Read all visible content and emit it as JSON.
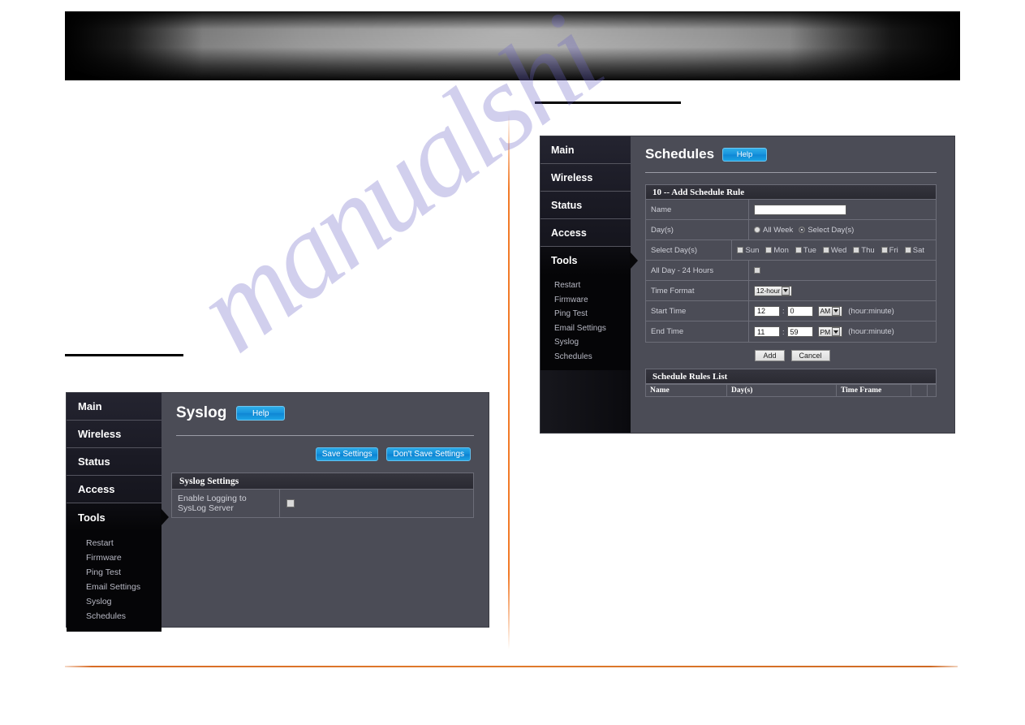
{
  "page": {
    "watermark_text": "manualshi",
    "accent_orange": "#d86c26",
    "panel_bg": "#4b4c56",
    "nav_bg": "#0a0a0e",
    "help_blue": "#1793dd"
  },
  "syslog_window": {
    "nav": {
      "main_items": [
        {
          "label": "Main",
          "active": false
        },
        {
          "label": "Wireless",
          "active": false
        },
        {
          "label": "Status",
          "active": false
        },
        {
          "label": "Access",
          "active": false
        },
        {
          "label": "Tools",
          "active": true
        }
      ],
      "sub_items": [
        {
          "label": "Restart"
        },
        {
          "label": "Firmware"
        },
        {
          "label": "Ping Test"
        },
        {
          "label": "Email Settings"
        },
        {
          "label": "Syslog"
        },
        {
          "label": "Schedules"
        }
      ]
    },
    "title": "Syslog",
    "help_label": "Help",
    "save_label": "Save Settings",
    "dont_save_label": "Don't Save Settings",
    "panel": {
      "heading": "Syslog Settings",
      "rows": [
        {
          "label": "Enable Logging to SysLog Server",
          "checked": false
        }
      ]
    }
  },
  "schedules_window": {
    "nav": {
      "main_items": [
        {
          "label": "Main",
          "active": false
        },
        {
          "label": "Wireless",
          "active": false
        },
        {
          "label": "Status",
          "active": false
        },
        {
          "label": "Access",
          "active": false
        },
        {
          "label": "Tools",
          "active": true
        }
      ],
      "sub_items": [
        {
          "label": "Restart"
        },
        {
          "label": "Firmware"
        },
        {
          "label": "Ping Test"
        },
        {
          "label": "Email Settings"
        },
        {
          "label": "Syslog"
        },
        {
          "label": "Schedules"
        }
      ]
    },
    "title": "Schedules",
    "help_label": "Help",
    "panel": {
      "heading": "10 -- Add Schedule Rule",
      "name_label": "Name",
      "name_value": "",
      "days_label": "Day(s)",
      "radio_all_week": "All Week",
      "radio_select_days": "Select Day(s)",
      "select_days_label": "Select Day(s)",
      "day_checkboxes": [
        {
          "label": "Sun",
          "checked": false
        },
        {
          "label": "Mon",
          "checked": false
        },
        {
          "label": "Tue",
          "checked": false
        },
        {
          "label": "Wed",
          "checked": false
        },
        {
          "label": "Thu",
          "checked": false
        },
        {
          "label": "Fri",
          "checked": false
        },
        {
          "label": "Sat",
          "checked": false
        }
      ],
      "all_day_label": "All Day - 24 Hours",
      "all_day_checked": false,
      "time_format_label": "Time Format",
      "time_format_value": "12-hour",
      "start_time_label": "Start Time",
      "start_hour": "12",
      "start_minute": "0",
      "start_meridiem": "AM",
      "start_hint": "(hour:minute)",
      "end_time_label": "End Time",
      "end_hour": "11",
      "end_minute": "59",
      "end_meridiem": "PM",
      "end_hint": "(hour:minute)"
    },
    "add_label": "Add",
    "cancel_label": "Cancel",
    "rules_list": {
      "heading": "Schedule Rules List",
      "columns": [
        "Name",
        "Day(s)",
        "Time Frame",
        "",
        ""
      ],
      "rows": []
    }
  }
}
